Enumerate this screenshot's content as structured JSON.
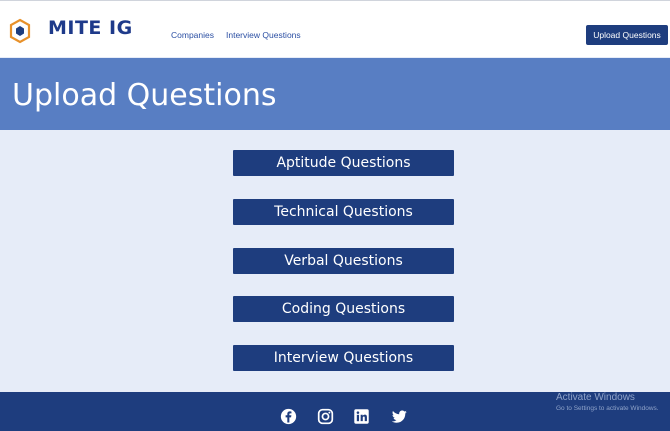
{
  "header": {
    "brand": "MITE IG",
    "nav": [
      "Companies",
      "Interview Questions"
    ],
    "upload_button": "Upload Questions"
  },
  "hero": {
    "title": "Upload Questions"
  },
  "question_buttons": [
    "Aptitude Questions",
    "Technical Questions",
    "Verbal Questions",
    "Coding Questions",
    "Interview Questions"
  ],
  "footer": {
    "social_icons": [
      "facebook-icon",
      "instagram-icon",
      "linkedin-icon",
      "twitter-icon"
    ]
  },
  "watermark": {
    "title": "Activate Windows",
    "subtitle": "Go to Settings to activate Windows."
  },
  "colors": {
    "primary": "#1e3d7e",
    "hero": "#587ec3",
    "background": "#e6ecf8",
    "logo_orange": "#e8912a"
  }
}
